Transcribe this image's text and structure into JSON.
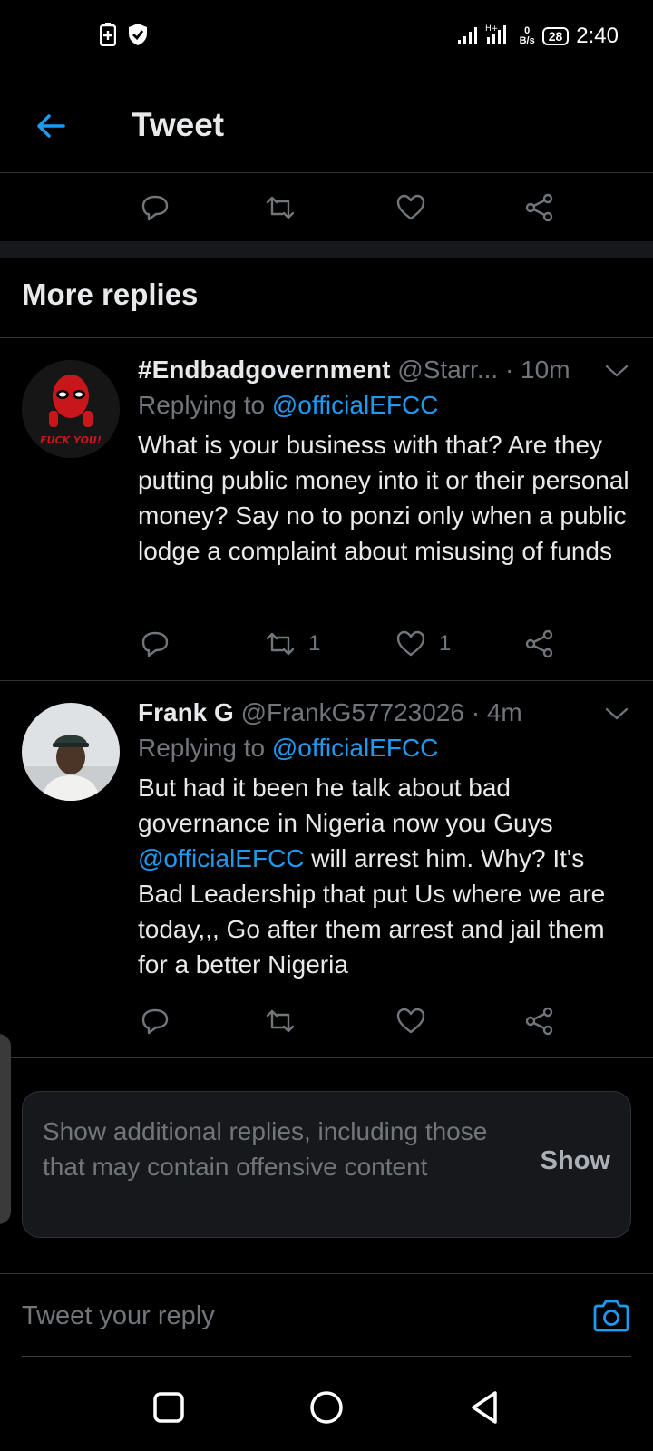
{
  "status_bar": {
    "network_speed_value": "0",
    "network_speed_unit": "B/s",
    "battery": "28",
    "time": "2:40"
  },
  "header": {
    "title": "Tweet"
  },
  "section": {
    "title": "More replies"
  },
  "replies": [
    {
      "name": "#Endbadgovernment",
      "handle": "@Starr...",
      "time": "· 10m",
      "replying_prefix": "Replying to ",
      "replying_to": "@officialEFCC",
      "avatar_caption": "FUCK YOU!",
      "text": "What is your business with that? Are they putting public money into it or their personal money? Say no to ponzi only when a public lodge a complaint about misusing of funds",
      "retweets": "1",
      "likes": "1"
    },
    {
      "name": "Frank G",
      "handle": "@FrankG57723026",
      "time": "· 4m",
      "replying_prefix": "Replying to ",
      "replying_to": "@officialEFCC",
      "text_before": "But had it been he talk about bad governance in Nigeria now you Guys ",
      "text_mention": "@officialEFCC",
      "text_after": " will arrest him. Why? It's Bad Leadership that put Us where we are today,,, Go after them arrest and jail them for a better Nigeria",
      "retweets": "",
      "likes": ""
    }
  ],
  "show_more": {
    "text": "Show additional replies, including those that may contain offensive content",
    "button": "Show"
  },
  "compose": {
    "placeholder": "Tweet your reply"
  },
  "colors": {
    "accent": "#1d9bf0",
    "background": "#000000",
    "muted": "#71767b"
  }
}
